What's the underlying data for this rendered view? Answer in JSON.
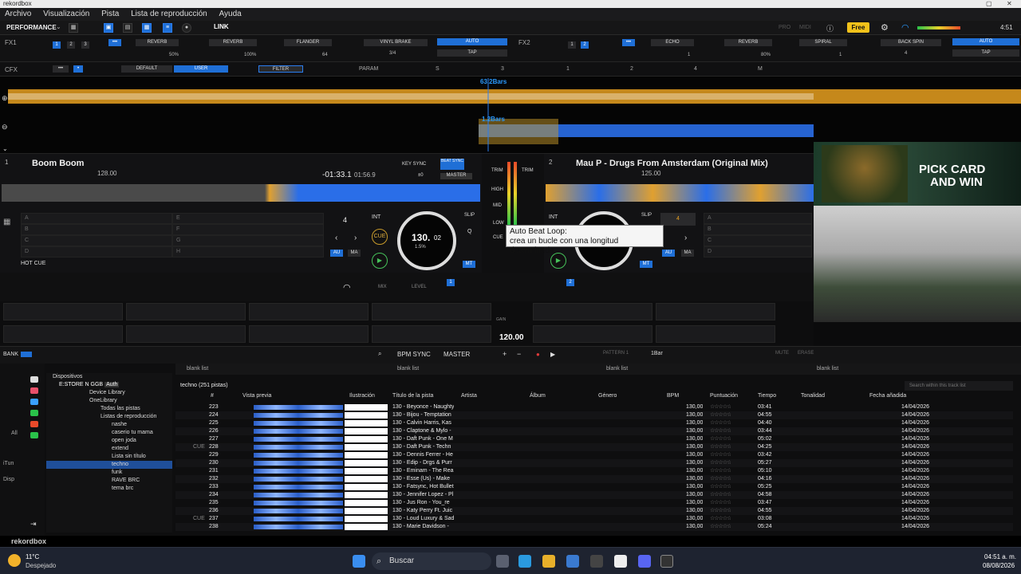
{
  "window": {
    "title": "rekordbox"
  },
  "menu": [
    "Archivo",
    "Visualización",
    "Pista",
    "Lista de reproducción",
    "Ayuda"
  ],
  "toolbar": {
    "mode": "PERFORMANCE",
    "link": "LINK",
    "pro": "PRO",
    "midi": "MIDI",
    "plan": "Free",
    "time": "4:51"
  },
  "fx1": {
    "label": "FX1",
    "slots": [
      "REVERB",
      "REVERB",
      "FLANGER"
    ],
    "vals": [
      "50%",
      "100%",
      "64"
    ],
    "brake": "VINYL BRAKE",
    "brake_val": "3/4",
    "auto": "AUTO",
    "tap": "TAP"
  },
  "fx2": {
    "label": "FX2",
    "slots": [
      "ECHO",
      "REVERB",
      "SPIRAL"
    ],
    "vals": [
      "1",
      "80%",
      "1"
    ],
    "brake": "BACK SPIN",
    "brake_val": "4",
    "auto": "AUTO",
    "tap": "TAP"
  },
  "cfx": {
    "label": "CFX",
    "default": "DEFAULT",
    "user": "USER",
    "filter": "FILTER",
    "param": "PARAM",
    "s": "S",
    "n3": "3",
    "n1": "1",
    "n2": "2",
    "n4": "4",
    "m": "M"
  },
  "waves": {
    "bars_top": "63.2Bars",
    "bars_bottom": "1.2Bars"
  },
  "deck1": {
    "num": "1",
    "title": "Boom Boom",
    "bpm": "128.00",
    "time_remain": "-01:33.1",
    "time_total": "01:56.9",
    "key_sync": "KEY SYNC",
    "key_val": "±0",
    "beat_sync": "BEAT SYNC",
    "master": "MASTER",
    "loop": "4",
    "int": "INT",
    "slip": "SLIP",
    "q": "Q",
    "jog_bpm": "130.",
    "jog_dec": "02",
    "jog_pct": "1.5%",
    "cue": "CUE",
    "au": "AU",
    "ma": "MA",
    "mt": "MT",
    "hotcue": "HOT CUE",
    "pads": [
      "A",
      "B",
      "C",
      "D",
      "E",
      "F",
      "G",
      "H"
    ]
  },
  "deck2": {
    "num": "2",
    "title": "Mau P - Drugs From Amsterdam (Original Mix)",
    "bpm": "125.00",
    "int": "INT",
    "slip": "SLIP",
    "loop": "4",
    "au": "AU",
    "ma": "MA",
    "mt": "MT",
    "pads": [
      "A",
      "B",
      "C",
      "D"
    ]
  },
  "mixer": {
    "trim": "TRIM",
    "high": "HIGH",
    "mid": "MID",
    "low": "LOW",
    "cue": "CUE",
    "mix": "MIX",
    "level": "LEVEL",
    "gain": "GAIN",
    "bpm": "120.00"
  },
  "tooltip": {
    "title": "Auto Beat Loop:",
    "body": "crea un bucle con una longitud determinada."
  },
  "ad": {
    "line1": "PICK CARD",
    "line2": "AND WIN"
  },
  "bottom": {
    "bank": "BANK",
    "bpm_sync": "BPM SYNC",
    "master": "MASTER",
    "pattern": "PATTERN 1",
    "bar": "1Bar",
    "mute": "MUTE",
    "erase": "ERASE"
  },
  "tabs": [
    "blank list",
    "blank list",
    "blank list",
    "blank list"
  ],
  "tree": {
    "devices": "Dispositivos",
    "store": "E:STORE N GGB",
    "auth": "Auth",
    "device_lib": "Device Library",
    "onelib": "OneLibrary",
    "all": "Todas las pistas",
    "lists": "Listas de reproducción",
    "playlists": [
      "nashe",
      "caserio tu mama",
      "open joda",
      "extend",
      "Lista sin título",
      "techno",
      "funk",
      "RAVE BRC",
      "tema brc"
    ],
    "left_all": "All",
    "left_itun": "iTun",
    "left_disp": "Disp"
  },
  "table": {
    "heading": "techno (251 pistas)",
    "search": "Search within this track list",
    "cols": [
      "#",
      "Vista previa",
      "Ilustración",
      "Título de la pista",
      "Artista",
      "Álbum",
      "Género",
      "BPM",
      "Puntuación",
      "Tiempo",
      "Tonalidad",
      "Fecha añadida"
    ],
    "rows": [
      {
        "cue": "",
        "n": "223",
        "title": "130 - Beyonce - Naughty",
        "bpm": "130,00",
        "time": "03:41",
        "date": "14/04/2026"
      },
      {
        "cue": "",
        "n": "224",
        "title": "130 - Bijou - Temptation",
        "bpm": "130,00",
        "time": "04:55",
        "date": "14/04/2026"
      },
      {
        "cue": "",
        "n": "225",
        "title": "130 - Calvin Harris, Kas",
        "bpm": "130,00",
        "time": "04:40",
        "date": "14/04/2026"
      },
      {
        "cue": "",
        "n": "226",
        "title": "130 - Claptone & Mylo -",
        "bpm": "130,00",
        "time": "03:44",
        "date": "14/04/2026"
      },
      {
        "cue": "",
        "n": "227",
        "title": "130 - Daft Punk - One M",
        "bpm": "130,00",
        "time": "05:02",
        "date": "14/04/2026"
      },
      {
        "cue": "CUE",
        "n": "228",
        "title": "130 - Daft Punk - Techn",
        "bpm": "130,00",
        "time": "04:25",
        "date": "14/04/2026"
      },
      {
        "cue": "",
        "n": "229",
        "title": "130 - Dennis Ferrer - He",
        "bpm": "130,00",
        "time": "03:42",
        "date": "14/04/2026"
      },
      {
        "cue": "",
        "n": "230",
        "title": "130 - Edip - Drgs & Purr",
        "bpm": "130,00",
        "time": "05:27",
        "date": "14/04/2026"
      },
      {
        "cue": "",
        "n": "231",
        "title": "130 - Eminam - The Rea",
        "bpm": "130,00",
        "time": "05:10",
        "date": "14/04/2026"
      },
      {
        "cue": "",
        "n": "232",
        "title": "130 - Esse (Us) - Make",
        "bpm": "130,00",
        "time": "04:16",
        "date": "14/04/2026"
      },
      {
        "cue": "",
        "n": "233",
        "title": "130 - Fatsync, Hot Bullet",
        "bpm": "130,00",
        "time": "05:25",
        "date": "14/04/2026"
      },
      {
        "cue": "",
        "n": "234",
        "title": "130 - Jennifer Lopez - Pl",
        "bpm": "130,00",
        "time": "04:58",
        "date": "14/04/2026"
      },
      {
        "cue": "",
        "n": "235",
        "title": "130 - Jus Ron - You_re",
        "bpm": "130,00",
        "time": "03:47",
        "date": "14/04/2026"
      },
      {
        "cue": "",
        "n": "236",
        "title": "130 - Katy Perry Ft. Juic",
        "bpm": "130,00",
        "time": "04:55",
        "date": "14/04/2026"
      },
      {
        "cue": "CUE",
        "n": "237",
        "title": "130 - Loud Luxury & Sad",
        "bpm": "130,00",
        "time": "03:08",
        "date": "14/04/2026"
      },
      {
        "cue": "",
        "n": "238",
        "title": "130 - Marie Davidson -",
        "bpm": "130,00",
        "time": "05:24",
        "date": "14/04/2026"
      }
    ]
  },
  "statusbar": {
    "brand": "rekordbox"
  },
  "taskbar": {
    "temp": "11°C",
    "weather": "Despejado",
    "search": "Buscar",
    "time": "04:51 a. m.",
    "date": "08/08/2026"
  },
  "colors": {
    "accent": "#1f6fd6",
    "orange_wave": "#e8a020",
    "blue_wave": "#2a6ee8",
    "free": "#f2c21a"
  }
}
